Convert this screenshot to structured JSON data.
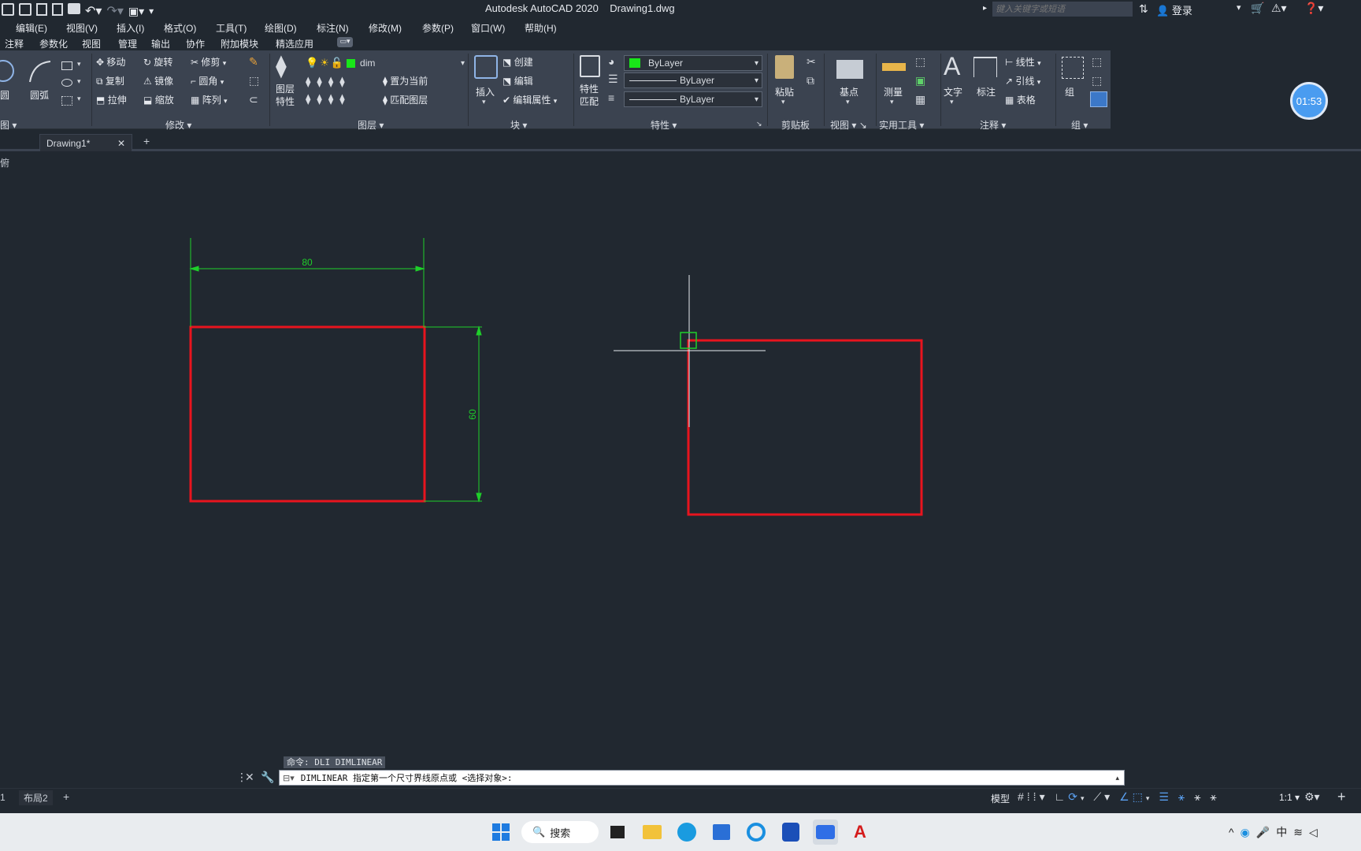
{
  "window": {
    "app_title": "Autodesk AutoCAD 2020",
    "file_title": "Drawing1.dwg",
    "search_placeholder": "键入关键字或短语",
    "login": "登录",
    "timer": "01:53"
  },
  "menubar": [
    "编辑(E)",
    "视图(V)",
    "插入(I)",
    "格式(O)",
    "工具(T)",
    "绘图(D)",
    "标注(N)",
    "修改(M)",
    "参数(P)",
    "窗口(W)",
    "帮助(H)"
  ],
  "ribbon_tabs": [
    "注释",
    "参数化",
    "视图",
    "管理",
    "输出",
    "协作",
    "附加模块",
    "精选应用"
  ],
  "ribbon": {
    "draw": {
      "circle": "圆",
      "arc": "圆弧",
      "title_fragment": "图"
    },
    "modify": {
      "move": "移动",
      "rotate": "旋转",
      "trim": "修剪",
      "copy": "复制",
      "mirror": "镜像",
      "fillet": "圆角",
      "stretch": "拉伸",
      "scale": "缩放",
      "array": "阵列",
      "title": "修改"
    },
    "layers": {
      "layer_props_line1": "图层",
      "layer_props_line2": "特性",
      "current_layer": "dim",
      "set_current": "置为当前",
      "match_layer": "匹配图层",
      "title": "图层"
    },
    "block": {
      "insert": "插入",
      "create": "创建",
      "edit": "编辑",
      "edit_attr": "编辑属性",
      "title": "块"
    },
    "properties": {
      "match_line1": "特性",
      "match_line2": "匹配",
      "color": "ByLayer",
      "linetype": "ByLayer",
      "lineweight": "ByLayer",
      "title": "特性"
    },
    "clipboard": {
      "paste": "粘贴",
      "title": "剪贴板"
    },
    "view": {
      "base": "基点",
      "title": "视图"
    },
    "utilities": {
      "measure": "测量",
      "title": "实用工具"
    },
    "annotation": {
      "text": "文字",
      "dim": "标注",
      "linear": "线性",
      "leader": "引线",
      "table": "表格",
      "title": "注释"
    },
    "groups": {
      "group": "组",
      "title": "组"
    }
  },
  "file_tabs": {
    "active": "Drawing1*"
  },
  "drawing": {
    "dim_horizontal": "80",
    "dim_vertical": "60",
    "viewport_label": "俯"
  },
  "command": {
    "history": "命令: DLI DIMLINEAR",
    "prompt": "DIMLINEAR 指定第一个尺寸界线原点或 <选择对象>:"
  },
  "status": {
    "layout_tab_1": "1",
    "layout_tab_2": "布局2",
    "model": "模型",
    "scale": "1:1"
  },
  "taskbar": {
    "search": "搜索",
    "ime": "中"
  },
  "colors": {
    "red_rect": "#e8141e",
    "dim_green": "#1fcf2a",
    "bg": "#212830",
    "ribbon": "#3b4350"
  }
}
